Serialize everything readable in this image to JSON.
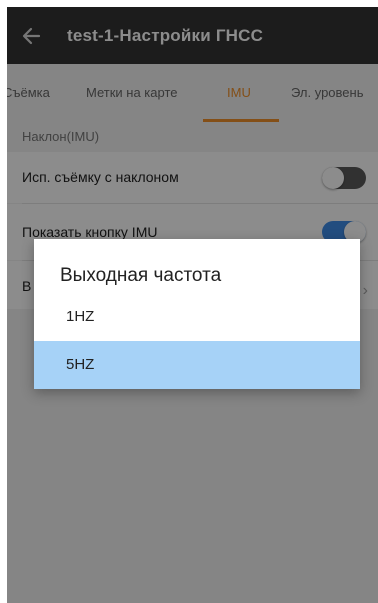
{
  "header": {
    "title": "test-1-Настройки ГНСС",
    "back_icon": "arrow-left-icon"
  },
  "tabs": [
    {
      "label": "Съёмка",
      "active": false
    },
    {
      "label": "Метки на карте",
      "active": false
    },
    {
      "label": "IMU",
      "active": true
    },
    {
      "label": "Эл. уровень",
      "active": false
    }
  ],
  "section": {
    "label": "Наклон(IMU)"
  },
  "settings": [
    {
      "label": "Исп. съёмку с наклоном",
      "control": "toggle",
      "on": false
    },
    {
      "label": "Показать кнопку IMU",
      "control": "toggle",
      "on": true
    },
    {
      "label": "В",
      "control": "chevron"
    }
  ],
  "dialog": {
    "title": "Выходная частота",
    "options": [
      {
        "label": "1HZ",
        "selected": false
      },
      {
        "label": "5HZ",
        "selected": true
      }
    ]
  },
  "colors": {
    "header_bg": "#333333",
    "accent": "#f0902a",
    "toggle_on": "#3f8de8",
    "selected_option_bg": "#a6d2f7"
  }
}
